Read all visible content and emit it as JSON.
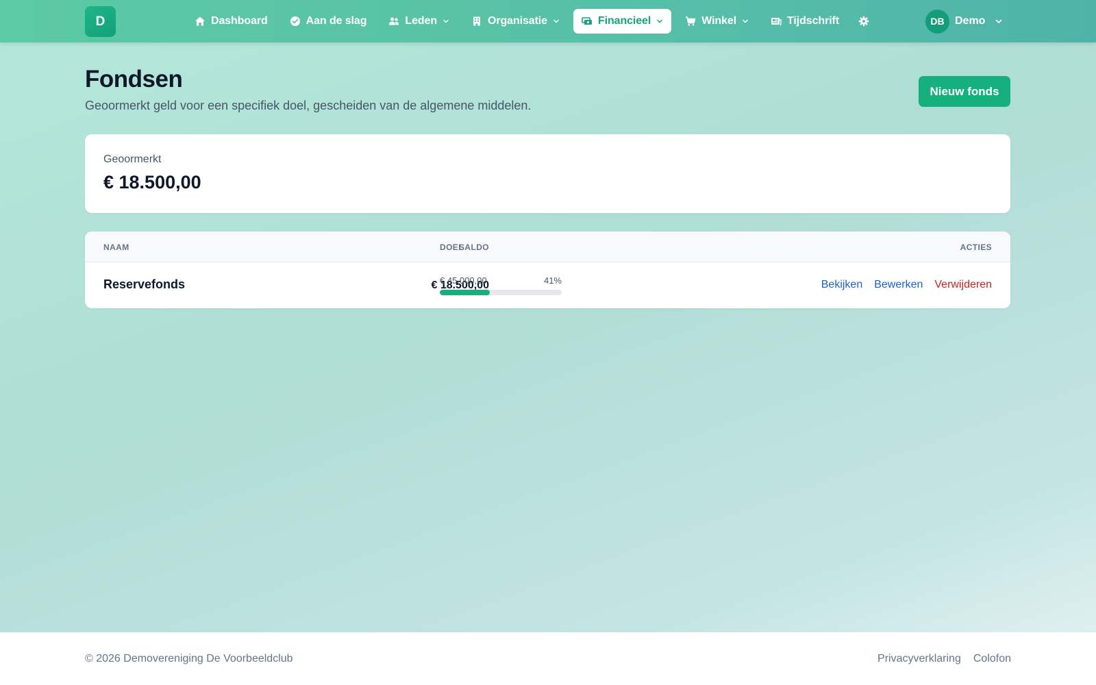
{
  "app": {
    "logo_letter": "D"
  },
  "nav": {
    "items": [
      {
        "label": "Dashboard",
        "icon": "home-icon"
      },
      {
        "label": "Aan de slag",
        "icon": "check-circle-icon"
      },
      {
        "label": "Leden",
        "icon": "users-icon"
      },
      {
        "label": "Organisatie",
        "icon": "building-icon"
      },
      {
        "label": "Financieel",
        "icon": "cash-icon",
        "active": true
      },
      {
        "label": "Winkel",
        "icon": "cart-icon"
      },
      {
        "label": "Tijdschrift",
        "icon": "magazine-icon"
      }
    ],
    "settings_icon": "gear-icon"
  },
  "user": {
    "initials": "DB",
    "name": "Demo"
  },
  "page": {
    "title": "Fondsen",
    "subtitle": "Geoormerkt geld voor een specifiek doel, gescheiden van de algemene middelen.",
    "new_button": "Nieuw fonds"
  },
  "summary": {
    "label": "Geoormerkt",
    "value": "€ 18.500,00"
  },
  "table": {
    "headers": {
      "name": "NAAM",
      "saldo": "SALDO",
      "goal": "DOEL",
      "actions": "ACTIES"
    },
    "rows": [
      {
        "name": "Reservefonds",
        "saldo": "€ 18.500,00",
        "goal_amount": "€ 45.000,00",
        "goal_percent": "41%",
        "progress": 0.41,
        "actions": {
          "view": "Bekijken",
          "edit": "Bewerken",
          "delete": "Verwijderen"
        }
      }
    ]
  },
  "footer": {
    "copyright": "© 2026 Demovereniging De Voorbeeldclub",
    "links": [
      "Privacyverklaring",
      "Colofon"
    ]
  },
  "colors": {
    "accent": "#16b07f",
    "link": "#1d5fd1",
    "danger": "#cc1f1f"
  }
}
